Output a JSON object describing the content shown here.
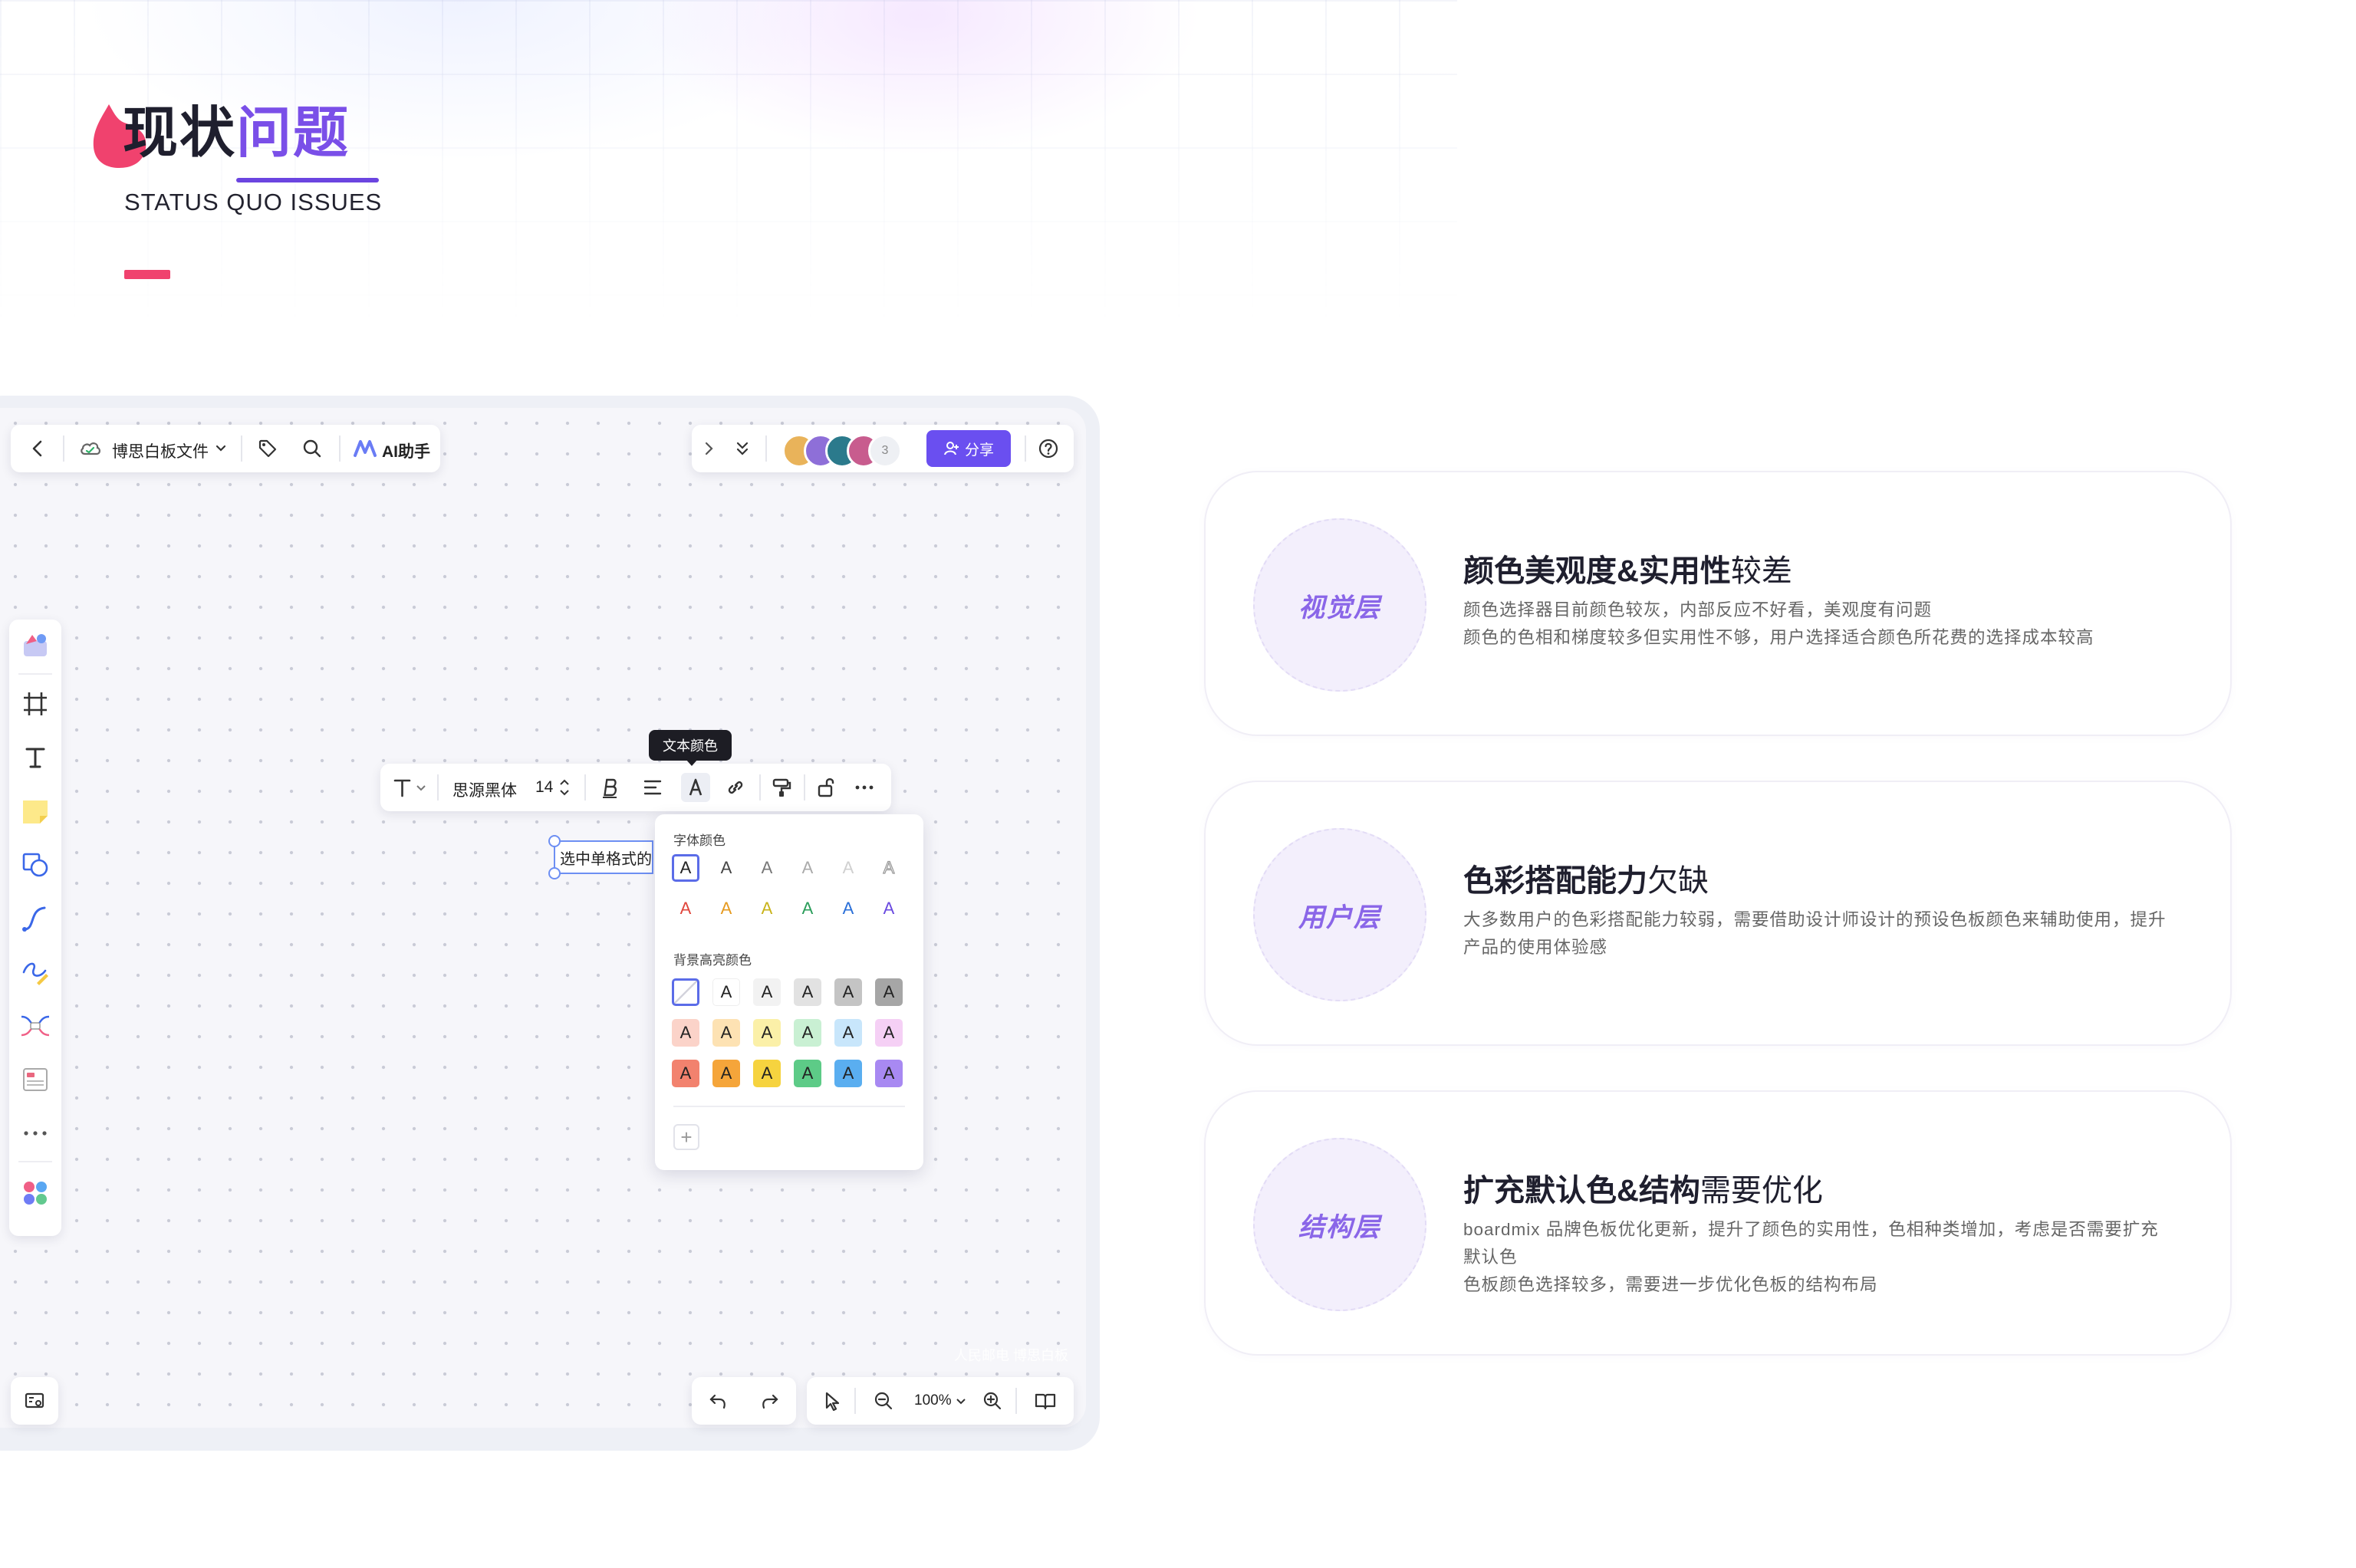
{
  "header": {
    "title_dark": "现状",
    "title_purple": "问题",
    "subtitle": "STATUS QUO ISSUES"
  },
  "mockup": {
    "toolbar_left": {
      "file_name": "博思白板文件",
      "ai_label": "AI助手"
    },
    "toolbar_right": {
      "collab_count": "3",
      "share_label": "分享"
    },
    "format_bar": {
      "font_name": "思源黑体",
      "font_size": "14",
      "tooltip": "文本颜色"
    },
    "textbox": {
      "text": "选中单格式的"
    },
    "color_panel": {
      "font_color_label": "字体颜色",
      "bg_color_label": "背景高亮颜色",
      "swatch_letter": "A",
      "font_rows": [
        [
          "#222222",
          "#444444",
          "#777777",
          "#aaaaaa",
          "#d0d0d0",
          "#bbbbbb"
        ],
        [
          "#e0453b",
          "#e69a1f",
          "#c9b31a",
          "#2a9d5a",
          "#2a6fd8",
          "#6a4ae0"
        ]
      ],
      "bg_rows": [
        [
          "none",
          "#ffffff",
          "#f2f2f2",
          "#e2e2e2",
          "#c4c4c4",
          "#a6a6a6"
        ],
        [
          "#fbd3c9",
          "#fde2b3",
          "#fbf0a8",
          "#c9f0d3",
          "#c8e6fb",
          "#f5d0f5"
        ],
        [
          "#f2826e",
          "#f5a53a",
          "#f6d33f",
          "#5dcb87",
          "#5aaef0",
          "#a889f2"
        ]
      ]
    },
    "zoom": "100%",
    "watermark": "人民邮电 博思白板"
  },
  "cards": [
    {
      "tag": "视觉层",
      "title_bold": "颜色美观度&实用性",
      "title_thin": "较差",
      "lines": [
        "颜色选择器目前颜色较灰，内部反应不好看，美观度有问题",
        "颜色的色相和梯度较多但实用性不够，用户选择适合颜色所花费的选择成本较高"
      ]
    },
    {
      "tag": "用户层",
      "title_bold": "色彩搭配能力",
      "title_thin": "欠缺",
      "lines": [
        "大多数用户的色彩搭配能力较弱，需要借助设计师设计的预设色板颜色来辅助使用，提升产品的使用体验感"
      ]
    },
    {
      "tag": "结构层",
      "title_bold": "扩充默认色&结构",
      "title_thin": "需要优化",
      "lines": [
        "boardmix 品牌色板优化更新，提升了颜色的实用性，色相种类增加，考虑是否需要扩充默认色",
        "色板颜色选择较多，需要进一步优化色板的结构布局"
      ]
    }
  ],
  "colors": {
    "accent_purple": "#7a4fe8",
    "accent_pink": "#f0426e",
    "share_button": "#6a4ff0"
  }
}
